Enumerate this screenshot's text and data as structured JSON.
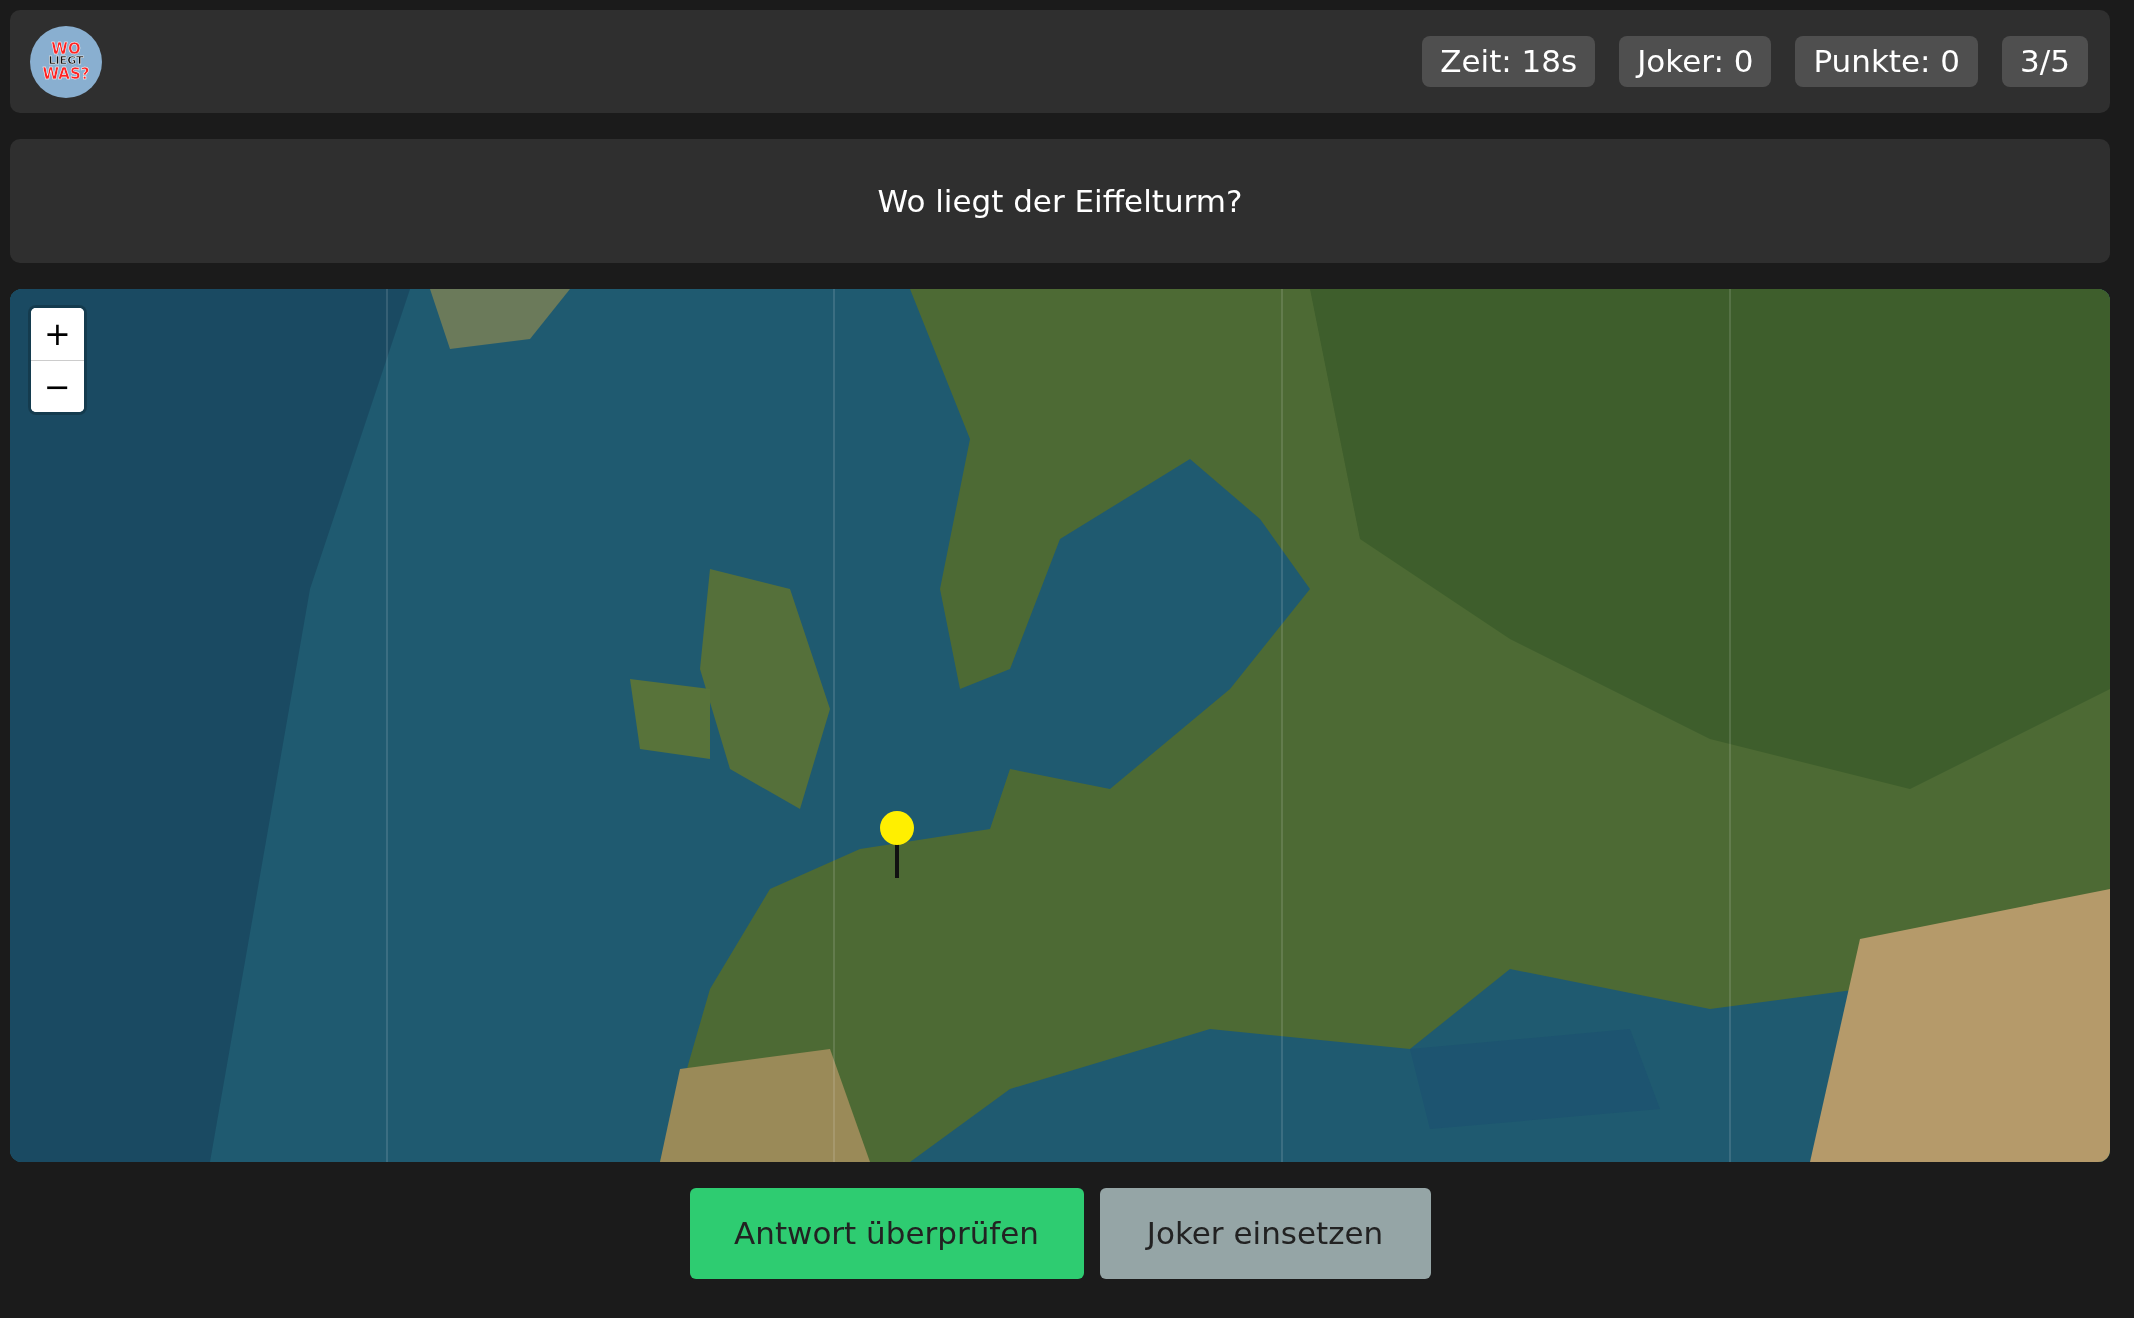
{
  "logo": {
    "lines": [
      "WO",
      "LIEGT",
      "WAS?"
    ]
  },
  "stats": [
    "Zeit: 18s",
    "Joker: 0",
    "Punkte: 0",
    "3/5"
  ],
  "question": "Wo liegt der Eiffelturm?",
  "map": {
    "zoom_in": "+",
    "zoom_out": "−"
  },
  "buttons": [
    {
      "label": "Antwort überprüfen",
      "kind": "primary"
    },
    {
      "label": "Joker einsetzen",
      "kind": "secondary"
    }
  ]
}
